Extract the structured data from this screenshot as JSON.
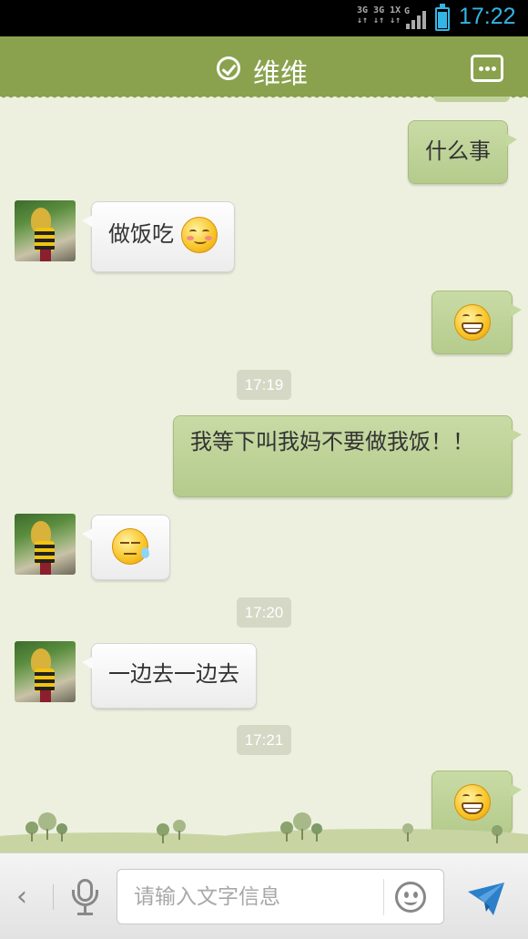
{
  "status_bar": {
    "signal_text_1": "3G 3G 1X",
    "signal_text_2": "↓↑ ↓↑ ↓↑",
    "signal_g": "G",
    "time": "17:22",
    "accent_color": "#33b5e5"
  },
  "header": {
    "title": "维维",
    "status_icon": "check-circle-icon",
    "menu_icon": "more-dots-icon",
    "bar_color": "#8aa24e"
  },
  "messages": [
    {
      "direction": "out",
      "text": "什么事",
      "emoji": null
    },
    {
      "direction": "in",
      "text": "做饭吃",
      "emoji": "smile-blush"
    },
    {
      "direction": "out",
      "text": "",
      "emoji": "grin"
    },
    {
      "type": "time",
      "text": "17:19"
    },
    {
      "direction": "out",
      "text": "我等下叫我妈不要做我饭！！",
      "emoji": null
    },
    {
      "direction": "in",
      "text": "",
      "emoji": "sweat"
    },
    {
      "type": "time",
      "text": "17:20"
    },
    {
      "direction": "in",
      "text": "一边去一边去",
      "emoji": null
    },
    {
      "type": "time",
      "text": "17:21"
    },
    {
      "direction": "out",
      "text": "",
      "emoji": "grin"
    }
  ],
  "input_bar": {
    "back_icon": "chevron-left-icon",
    "back_glyph": "‹",
    "mic_icon": "microphone-icon",
    "placeholder": "请输入文字信息",
    "emoji_icon": "smiley-icon",
    "send_icon": "paper-plane-icon",
    "send_color": "#2c7fc9"
  }
}
